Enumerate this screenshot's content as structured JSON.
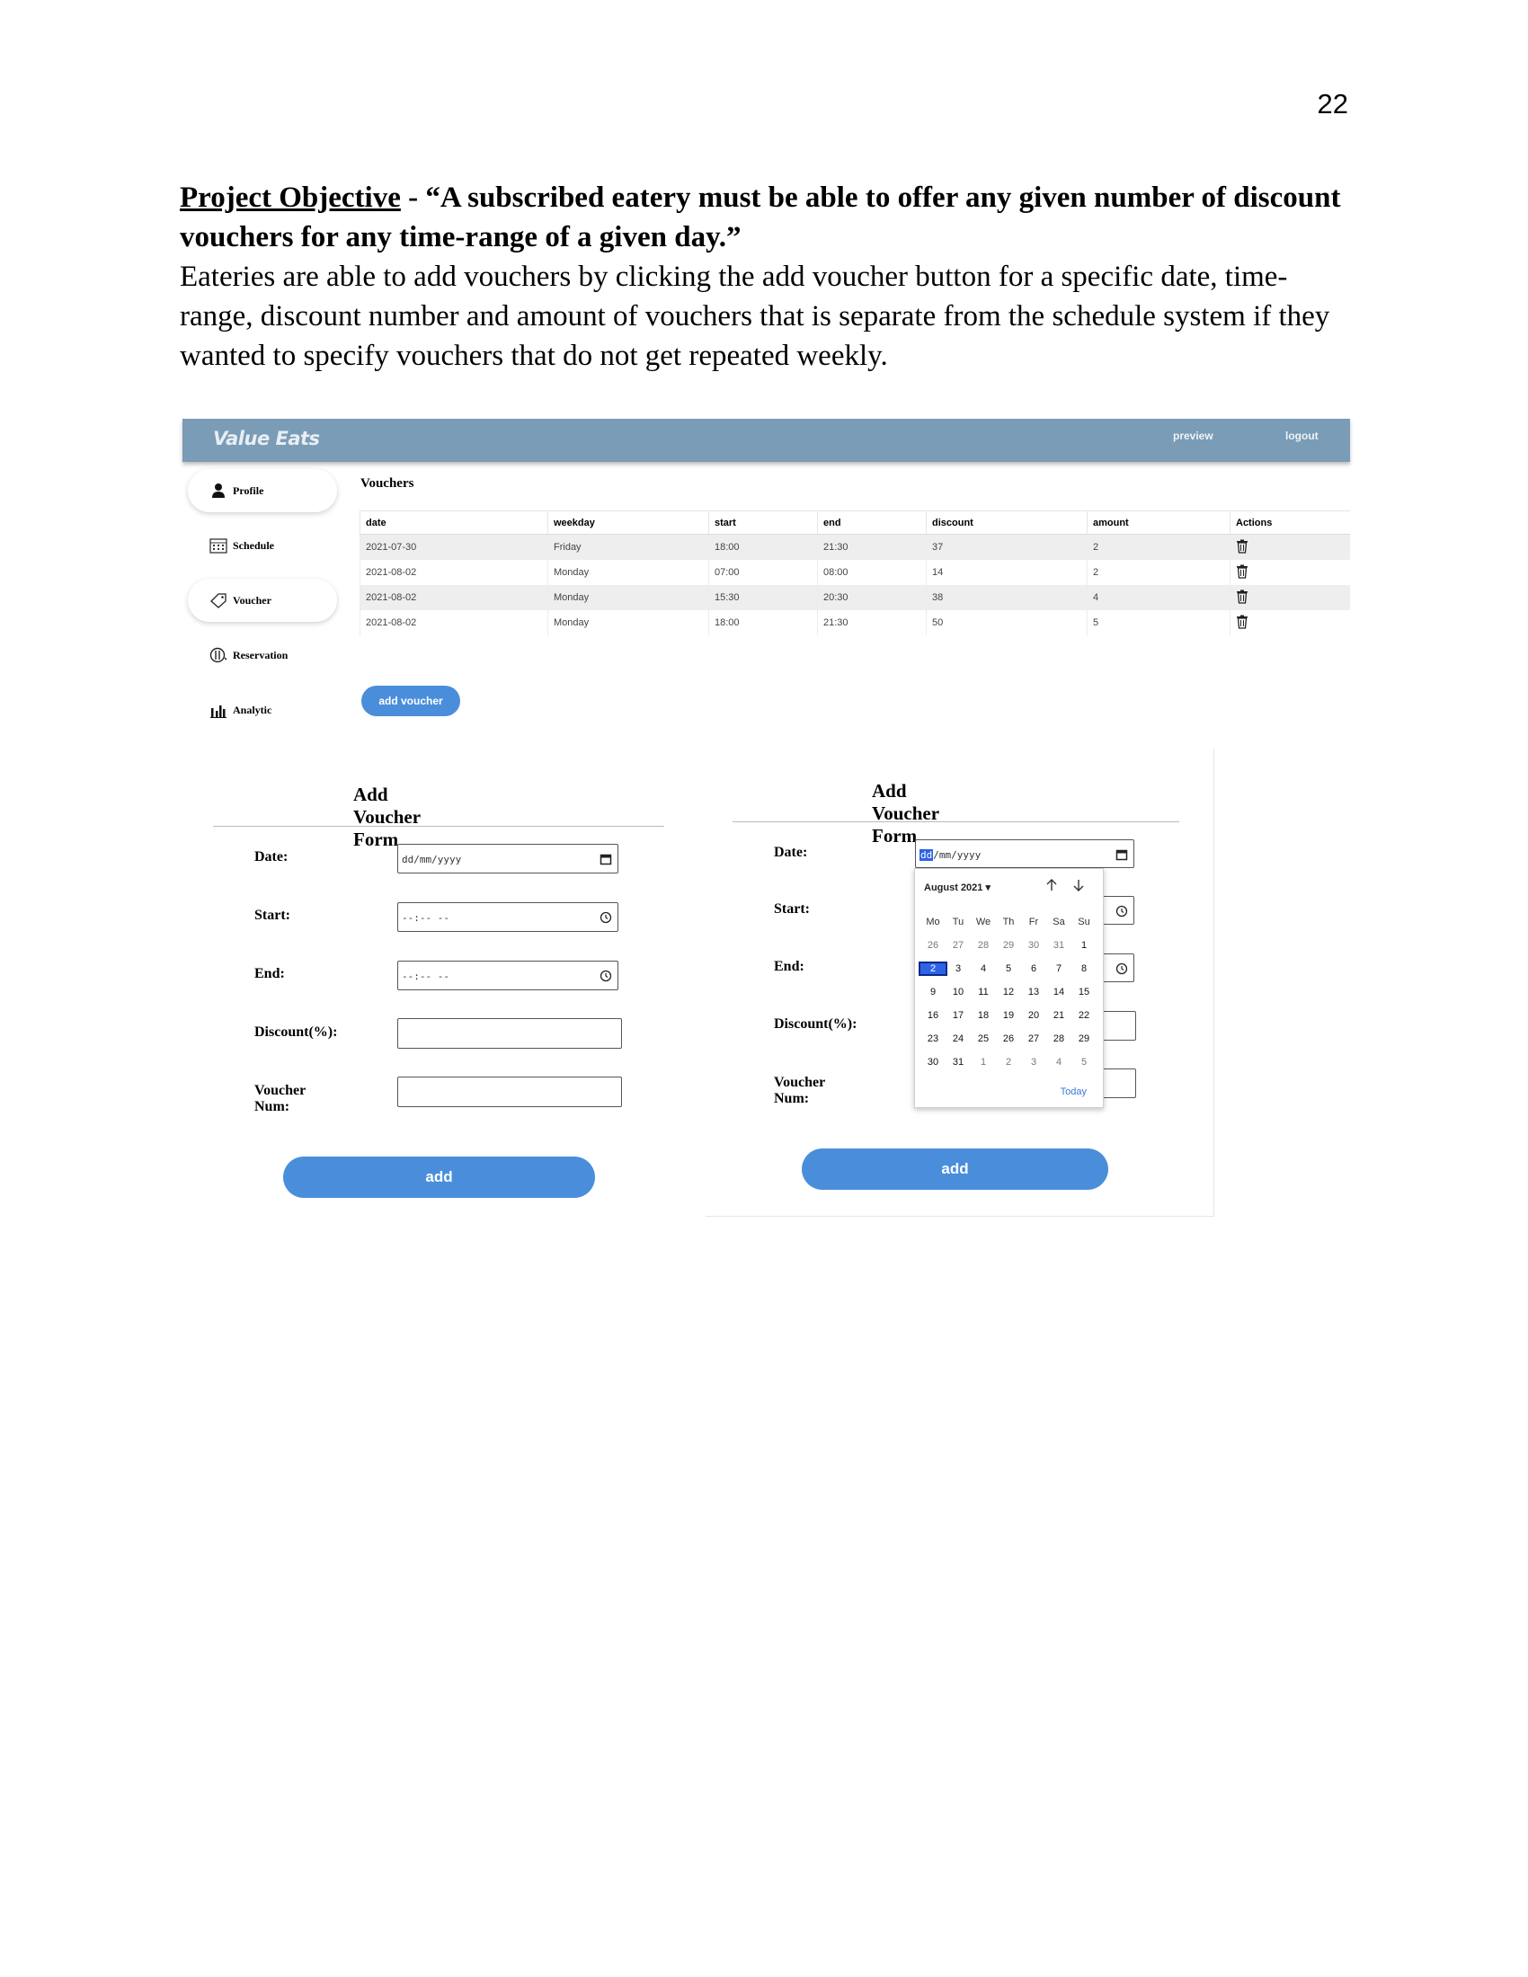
{
  "page": {
    "number": "22"
  },
  "objective": {
    "label": "Project Objective",
    "dash": " - ",
    "quote": "“A subscribed eatery must be able to offer any given number of discount vouchers for any time-range of a given day.”",
    "body": "Eateries are able to add vouchers by clicking the add voucher button for a specific date, time-range, discount number and amount of vouchers that is separate from the schedule system if they wanted to specify vouchers that do not get repeated weekly."
  },
  "app": {
    "logo": "Value Eats",
    "topnav": {
      "preview": "preview",
      "logout": "logout"
    },
    "sidebar": [
      {
        "label": "Profile",
        "icon": "person-icon",
        "active": true
      },
      {
        "label": "Schedule",
        "icon": "calendar-icon",
        "active": false
      },
      {
        "label": "Voucher",
        "icon": "tag-icon",
        "active": true
      },
      {
        "label": "Reservation",
        "icon": "cutlery-icon",
        "active": false
      },
      {
        "label": "Analytic",
        "icon": "bar-chart-icon",
        "active": false
      }
    ],
    "vouchers": {
      "title": "Vouchers",
      "columns": [
        "date",
        "weekday",
        "start",
        "end",
        "discount",
        "amount",
        "Actions"
      ],
      "rows": [
        {
          "date": "2021-07-30",
          "weekday": "Friday",
          "start": "18:00",
          "end": "21:30",
          "discount": "37",
          "amount": "2"
        },
        {
          "date": "2021-08-02",
          "weekday": "Monday",
          "start": "07:00",
          "end": "08:00",
          "discount": "14",
          "amount": "2"
        },
        {
          "date": "2021-08-02",
          "weekday": "Monday",
          "start": "15:30",
          "end": "20:30",
          "discount": "38",
          "amount": "4"
        },
        {
          "date": "2021-08-02",
          "weekday": "Monday",
          "start": "18:00",
          "end": "21:30",
          "discount": "50",
          "amount": "5"
        }
      ],
      "add_button": "add voucher"
    }
  },
  "form": {
    "title": "Add Voucher Form",
    "labels": {
      "date": "Date:",
      "start": "Start:",
      "end": "End:",
      "discount": "Discount(%):",
      "num": "Voucher Num:"
    },
    "placeholders": {
      "date_dd": "dd",
      "date_rest": "/mm/yyyy",
      "date_full": "dd/mm/yyyy",
      "time": "--:-- --"
    },
    "add_button": "add"
  },
  "calendar": {
    "month": "August 2021 ▾",
    "weekdays": [
      "Mo",
      "Tu",
      "We",
      "Th",
      "Fr",
      "Sa",
      "Su"
    ],
    "weeks": [
      [
        "26",
        "27",
        "28",
        "29",
        "30",
        "31",
        "1"
      ],
      [
        "2",
        "3",
        "4",
        "5",
        "6",
        "7",
        "8"
      ],
      [
        "9",
        "10",
        "11",
        "12",
        "13",
        "14",
        "15"
      ],
      [
        "16",
        "17",
        "18",
        "19",
        "20",
        "21",
        "22"
      ],
      [
        "23",
        "24",
        "25",
        "26",
        "27",
        "28",
        "29"
      ],
      [
        "30",
        "31",
        "1",
        "2",
        "3",
        "4",
        "5"
      ]
    ],
    "selected": "2",
    "today": "Today"
  }
}
